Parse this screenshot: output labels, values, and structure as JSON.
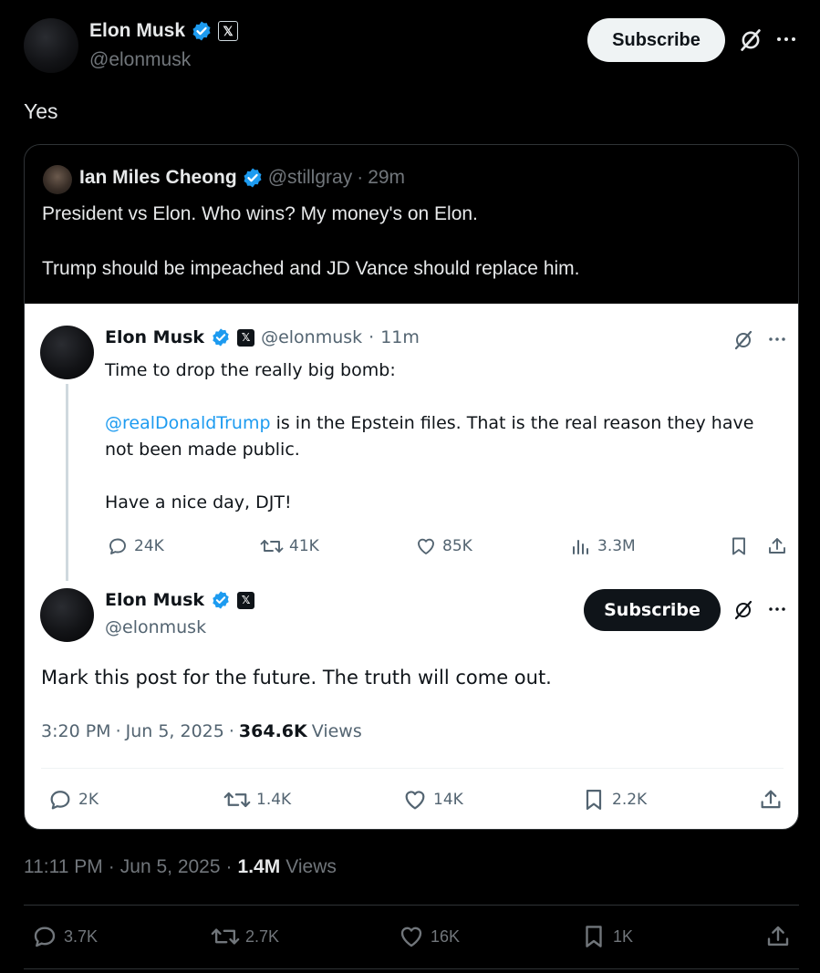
{
  "author": {
    "name": "Elon Musk",
    "handle": "@elonmusk",
    "subscribe_label": "Subscribe",
    "x_badge": "𝕏"
  },
  "post": {
    "text": "Yes",
    "time": "11:11 PM",
    "date": "Jun 5, 2025",
    "views_count": "1.4M",
    "views_label": "Views",
    "stats": {
      "replies": "3.7K",
      "reposts": "2.7K",
      "likes": "16K",
      "bookmarks": "1K"
    }
  },
  "quote": {
    "author_name": "Ian Miles Cheong",
    "author_handle": "@stillgray",
    "age": "29m",
    "line1": "President vs Elon. Who wins? My money's on Elon.",
    "line2": "Trump should be impeached and JD Vance should replace him."
  },
  "screenshot_tweet1": {
    "name": "Elon Musk",
    "handle": "@elonmusk",
    "age": "11m",
    "line1": "Time to drop the really big bomb:",
    "mention": "@realDonaldTrump",
    "line2_rest": " is in the Epstein files. That is the real reason they have",
    "line2_cont": "not been made public.",
    "line3": "Have a nice day, DJT!",
    "stats": {
      "replies": "24K",
      "reposts": "41K",
      "likes": "85K",
      "views": "3.3M"
    }
  },
  "screenshot_tweet2": {
    "name": "Elon Musk",
    "handle": "@elonmusk",
    "subscribe_label": "Subscribe",
    "text": "Mark this post for the future. The truth will come out.",
    "time": "3:20 PM",
    "date": "Jun 5, 2025",
    "views_count": "364.6K",
    "views_label": "Views",
    "stats": {
      "replies": "2K",
      "reposts": "1.4K",
      "likes": "14K",
      "bookmarks": "2.2K"
    }
  },
  "separator": "·",
  "colors": {
    "accent": "#1d9bf0",
    "background": "#000000",
    "card_border": "#2f3336",
    "text": "#e7e9ea",
    "muted": "#71767b"
  },
  "icons": [
    "verified-badge-icon",
    "grok-icon",
    "more-icon",
    "reply-icon",
    "repost-icon",
    "like-icon",
    "views-icon",
    "bookmark-icon",
    "share-icon"
  ]
}
